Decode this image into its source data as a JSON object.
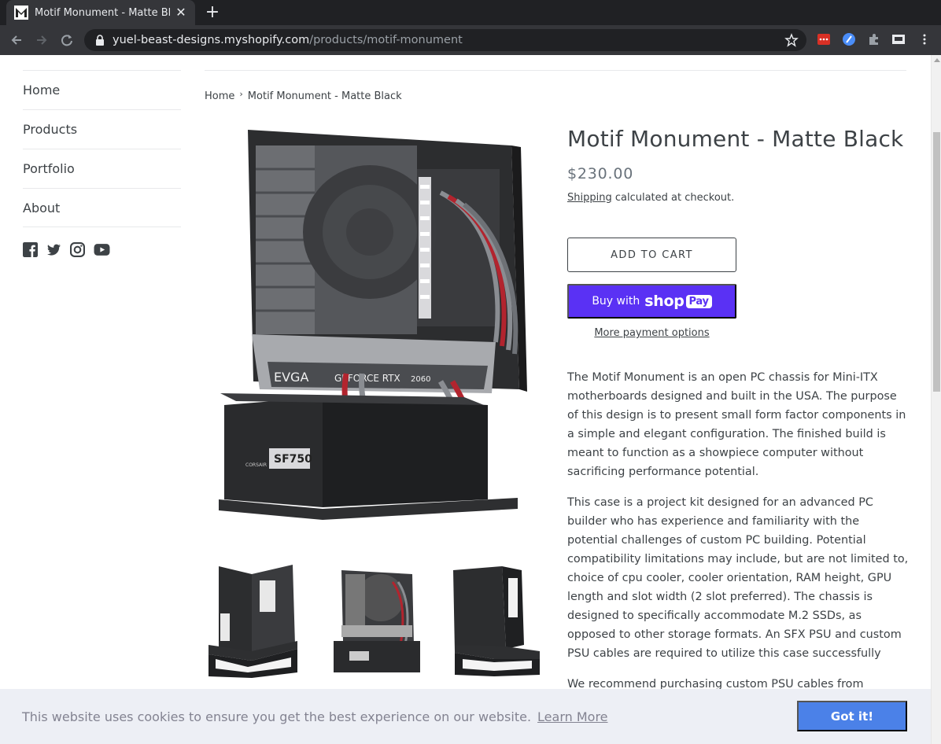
{
  "browser": {
    "tab_title": "Motif Monument - Matte Bl",
    "url_host": "yuel-beast-designs.myshopify.com",
    "url_path": "/products/motif-monument"
  },
  "sidebar": {
    "items": [
      {
        "label": "Home"
      },
      {
        "label": "Products"
      },
      {
        "label": "Portfolio"
      },
      {
        "label": "About"
      }
    ],
    "socials": [
      "facebook-icon",
      "twitter-icon",
      "instagram-icon",
      "youtube-icon"
    ]
  },
  "breadcrumb": {
    "home": "Home",
    "separator": "›",
    "current": "Motif Monument - Matte Black"
  },
  "product": {
    "title": "Motif Monument - Matte Black",
    "price": "$230.00",
    "shipping_link": "Shipping",
    "shipping_rest": " calculated at checkout.",
    "add_to_cart": "ADD TO CART",
    "buy_with": "Buy with",
    "shop_logo_text": "shop",
    "shop_logo_pay": "Pay",
    "more_payment_options": "More payment options",
    "description": [
      "The Motif Monument is an open PC chassis for Mini-ITX motherboards designed and built in the USA. The purpose of this design is to present small form factor components in a simple and elegant configuration. The finished build is meant to function as a showpiece computer without sacrificing performance potential.",
      "This case is a project kit designed for an advanced PC builder who has experience and familiarity with the potential challenges of custom PC building. Potential compatibility limitations may include, but are not limited to, choice of cpu cooler, cooler orientation, RAM height, GPU length and slot width (2 slot preferred). The chassis is designed to specifically accommodate M.2 SSDs, as opposed to other storage formats. An SFX PSU and custom PSU cables are required to utilize this case successfully",
      "We recommend purchasing custom PSU cables from"
    ],
    "image_labels": {
      "gpu_brand": "EVGA",
      "gpu_model": "GEFORCE RTX",
      "gpu_number": "2060",
      "psu_brand": "CORSAIR",
      "psu_model": "SF750"
    }
  },
  "cookie": {
    "message": "This website uses cookies to ensure you get the best experience on our website.",
    "learn_more": "Learn More",
    "dismiss": "Got it!"
  },
  "colors": {
    "shop_pay": "#5a31f4",
    "cookie_button": "#4b81e8",
    "cookie_bg": "#edeff5",
    "text": "#3d4246"
  }
}
